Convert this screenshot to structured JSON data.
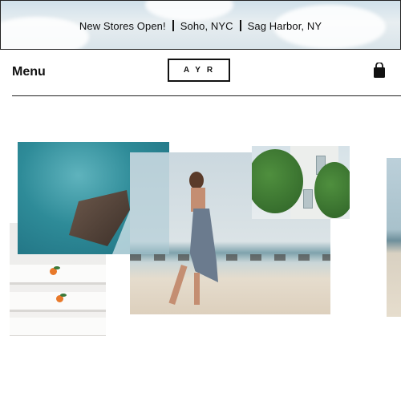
{
  "announcement": {
    "part1": "New Stores Open!",
    "part2": "Soho, NYC",
    "part3": "Sag Harbor, NY"
  },
  "nav": {
    "menu_label": "Menu",
    "logo_text": "AYR",
    "bag_icon": "shopping-bag-icon"
  },
  "colors": {
    "text": "#111111",
    "rule": "#222222",
    "background": "#ffffff"
  }
}
